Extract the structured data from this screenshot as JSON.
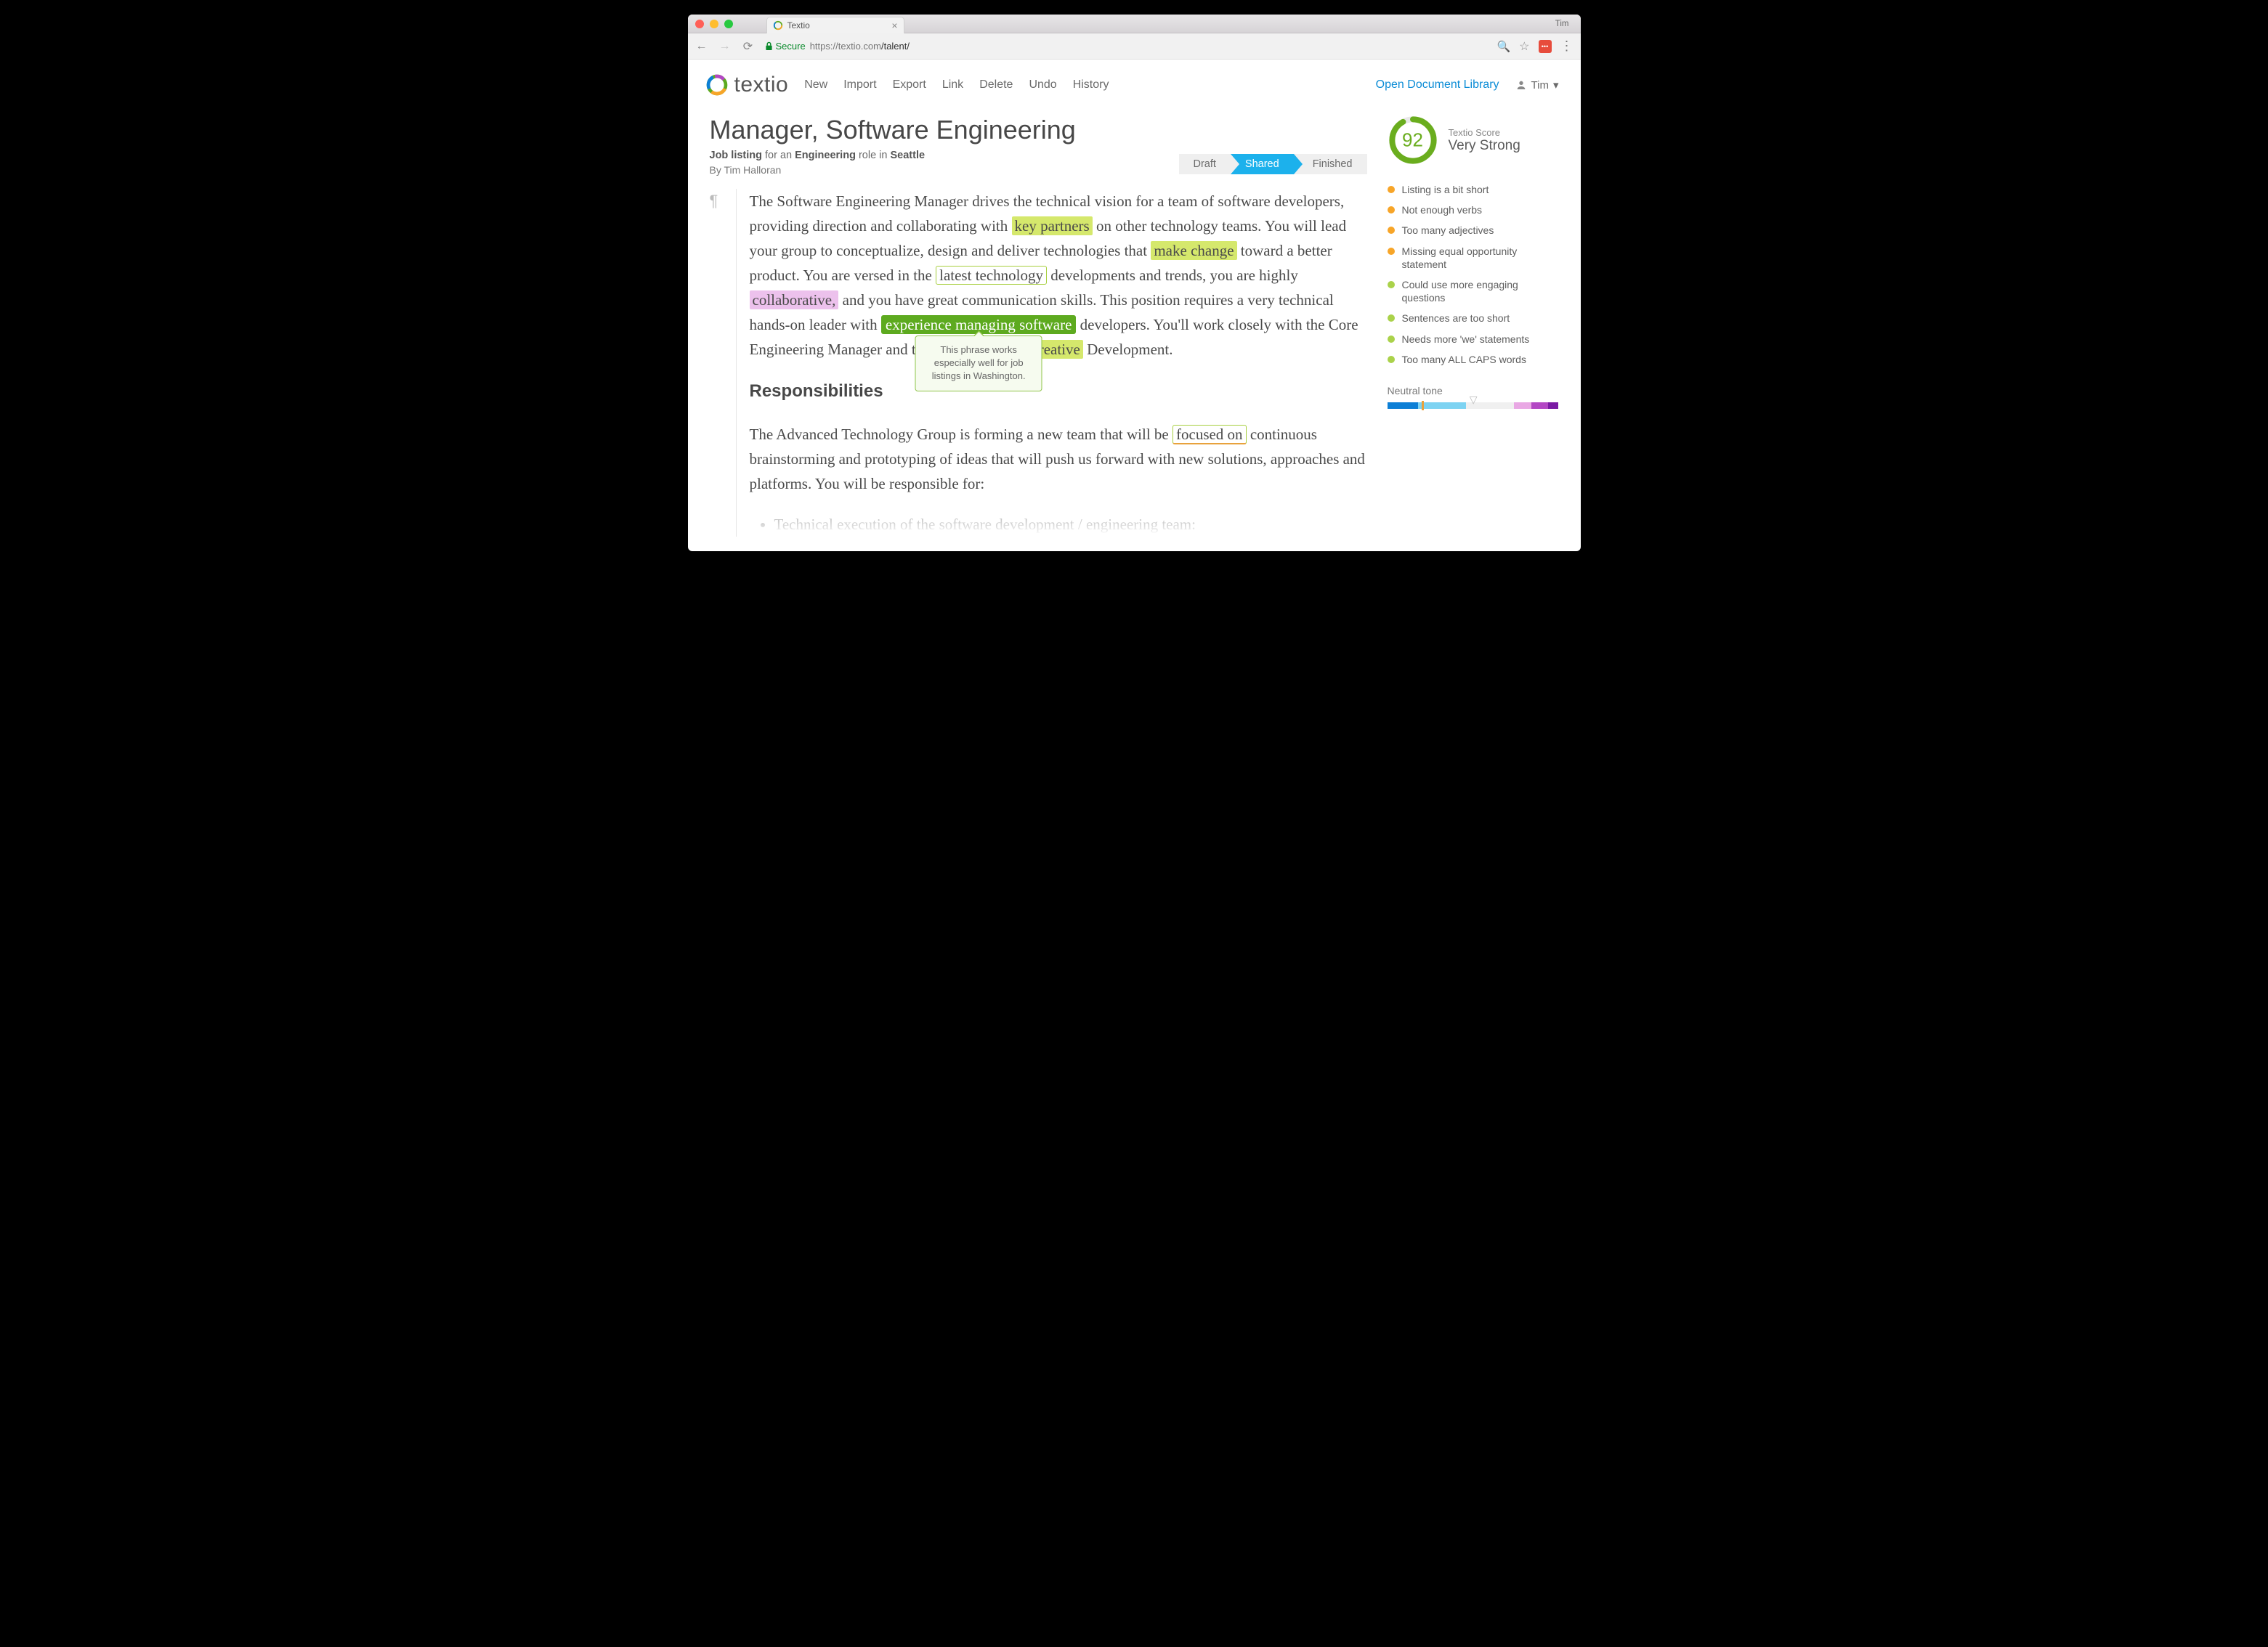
{
  "browser": {
    "tab_title": "Textio",
    "user_label": "Tim",
    "secure_label": "Secure",
    "url_host": "https://textio.com",
    "url_path": "/talent/"
  },
  "header": {
    "brand": "textio",
    "menu": [
      "New",
      "Import",
      "Export",
      "Link",
      "Delete",
      "Undo",
      "History"
    ],
    "library_link": "Open Document Library",
    "user": "Tim"
  },
  "document": {
    "title": "Manager, Software Engineering",
    "meta_prefix": "Job listing",
    "meta_mid1": " for an ",
    "meta_role": "Engineering",
    "meta_mid2": " role in ",
    "meta_place": "Seattle",
    "byline": "By Tim Halloran",
    "status": {
      "draft": "Draft",
      "shared": "Shared",
      "finished": "Finished"
    },
    "p1": {
      "t1": "The Software Engineering Manager drives the technical vision for a team of software developers, providing direction and collaborating with ",
      "h_key": "key partners",
      "t2": " on other technology teams. You will lead your group to conceptualize, design and deliver technologies that ",
      "h_make": "make change",
      "t3": " toward a better product. You are versed in the ",
      "h_latest": "latest technology",
      "t4": " developments and trends, you are highly ",
      "h_collab": "collaborative,",
      "t5": " and you have great communication skills. This position requires a very technical hands-on leader with ",
      "h_exp": "experience managing software",
      "t6": " developers. You'll work closely with the Core Engineering Manager and the Sr. Director of ",
      "h_creative": "Creative",
      "t7": " Development."
    },
    "tooltip": "This phrase works especially well for job listings in Washington.",
    "h2": "Responsibilities",
    "p2": {
      "t1": "The Advanced Technology Group is forming a new team that will be ",
      "h_focus": "focused on",
      "t2": " continuous brainstorming and prototyping of ideas that will push us forward with new solutions, approaches and platforms. You will be responsible for:"
    },
    "bullet1": "Technical execution of the software development / engineering team:"
  },
  "sidebar": {
    "score_num": "92",
    "score_label": "Textio Score",
    "score_strength": "Very Strong",
    "issues": [
      {
        "c": "orange",
        "t": "Listing is a bit short"
      },
      {
        "c": "orange",
        "t": "Not enough verbs"
      },
      {
        "c": "orange",
        "t": "Too many adjectives"
      },
      {
        "c": "orange",
        "t": "Missing equal opportunity statement"
      },
      {
        "c": "lime",
        "t": "Could use more engaging questions"
      },
      {
        "c": "lime",
        "t": "Sentences are too short"
      },
      {
        "c": "lime",
        "t": "Needs more 'we' statements"
      },
      {
        "c": "lime",
        "t": "Too many ALL CAPS words"
      }
    ],
    "tone_label": "Neutral tone"
  }
}
